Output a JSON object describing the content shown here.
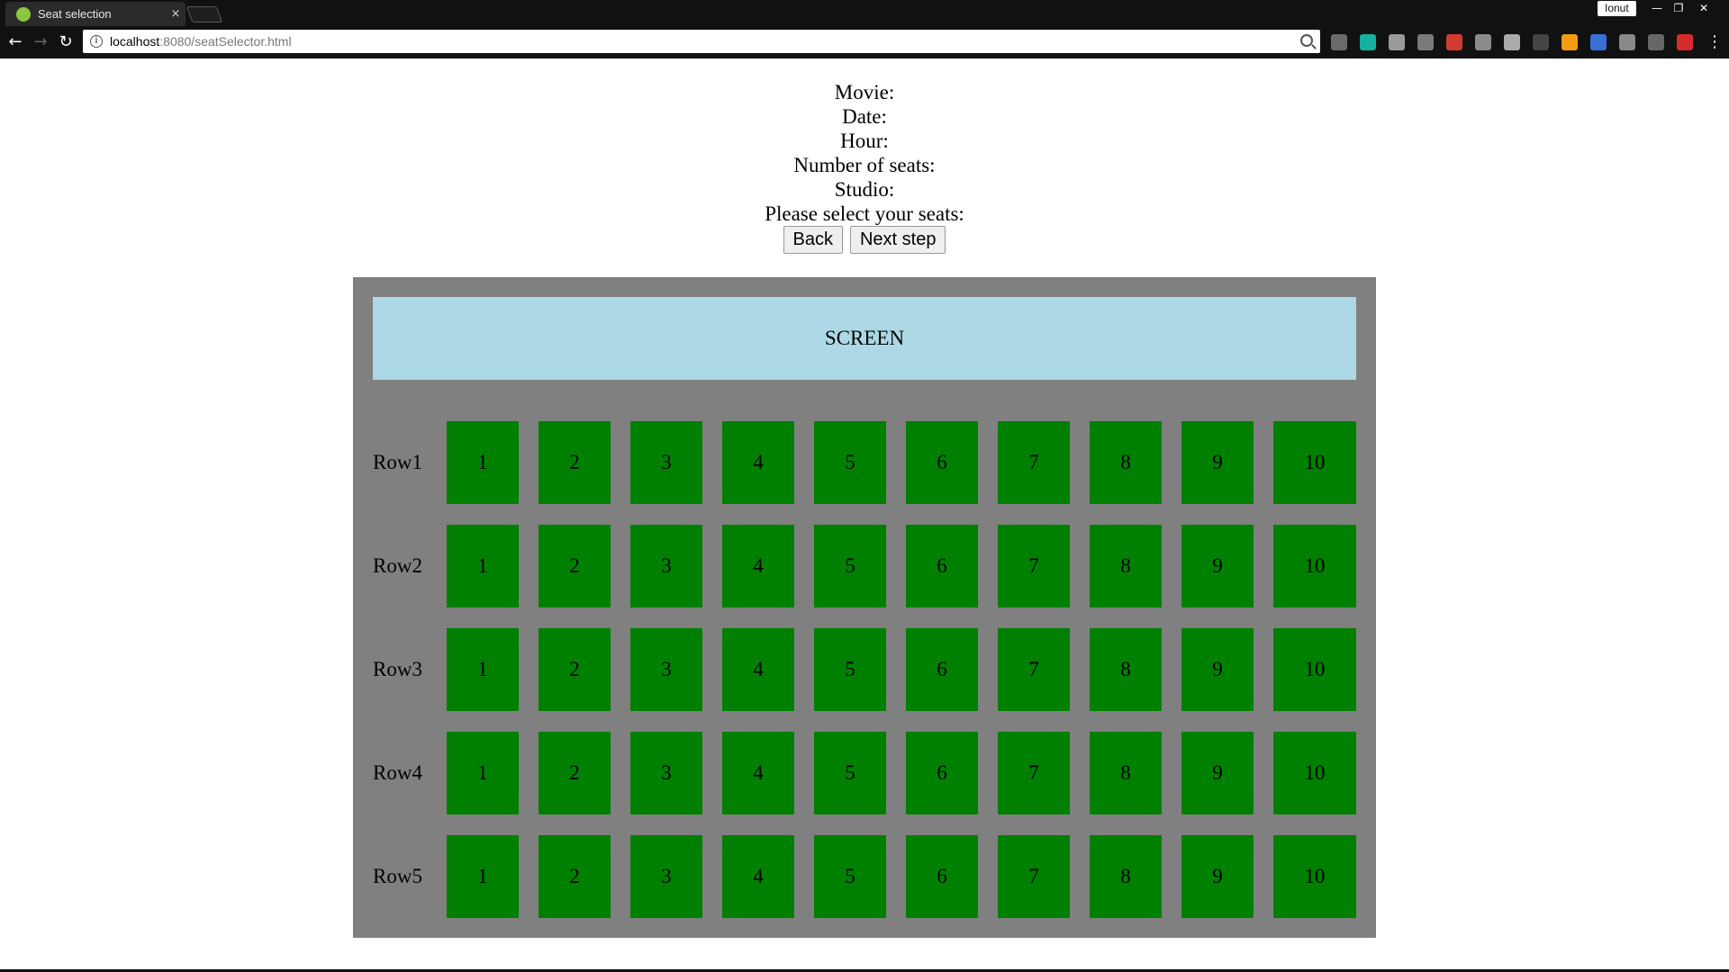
{
  "browser": {
    "tab_title": "Seat selection",
    "tab_close": "×",
    "profile_name": "Ionut",
    "url_host": "localhost",
    "url_rest": ":8080/seatSelector.html",
    "ext_colors": [
      "#6a6a6a",
      "#15b0a0",
      "#9a9a9a",
      "#7a7a7a",
      "#d23b2f",
      "#8a8a8a",
      "#aaaaaa",
      "#444444",
      "#f39c12",
      "#3b6fd8",
      "#888888",
      "#666666",
      "#d62b2b"
    ]
  },
  "info": {
    "movie_label": "Movie:",
    "date_label": "Date:",
    "hour_label": "Hour:",
    "seats_label": "Number of seats:",
    "studio_label": "Studio:",
    "prompt": "Please select your seats:"
  },
  "buttons": {
    "back": "Back",
    "next": "Next step"
  },
  "theater": {
    "screen_label": "SCREEN",
    "seat_color": "#008000",
    "screen_color": "#add8e6",
    "background_color": "#808080",
    "rows": [
      {
        "label": "Row1",
        "seats": [
          "1",
          "2",
          "3",
          "4",
          "5",
          "6",
          "7",
          "8",
          "9",
          "10"
        ]
      },
      {
        "label": "Row2",
        "seats": [
          "1",
          "2",
          "3",
          "4",
          "5",
          "6",
          "7",
          "8",
          "9",
          "10"
        ]
      },
      {
        "label": "Row3",
        "seats": [
          "1",
          "2",
          "3",
          "4",
          "5",
          "6",
          "7",
          "8",
          "9",
          "10"
        ]
      },
      {
        "label": "Row4",
        "seats": [
          "1",
          "2",
          "3",
          "4",
          "5",
          "6",
          "7",
          "8",
          "9",
          "10"
        ]
      },
      {
        "label": "Row5",
        "seats": [
          "1",
          "2",
          "3",
          "4",
          "5",
          "6",
          "7",
          "8",
          "9",
          "10"
        ]
      }
    ]
  }
}
